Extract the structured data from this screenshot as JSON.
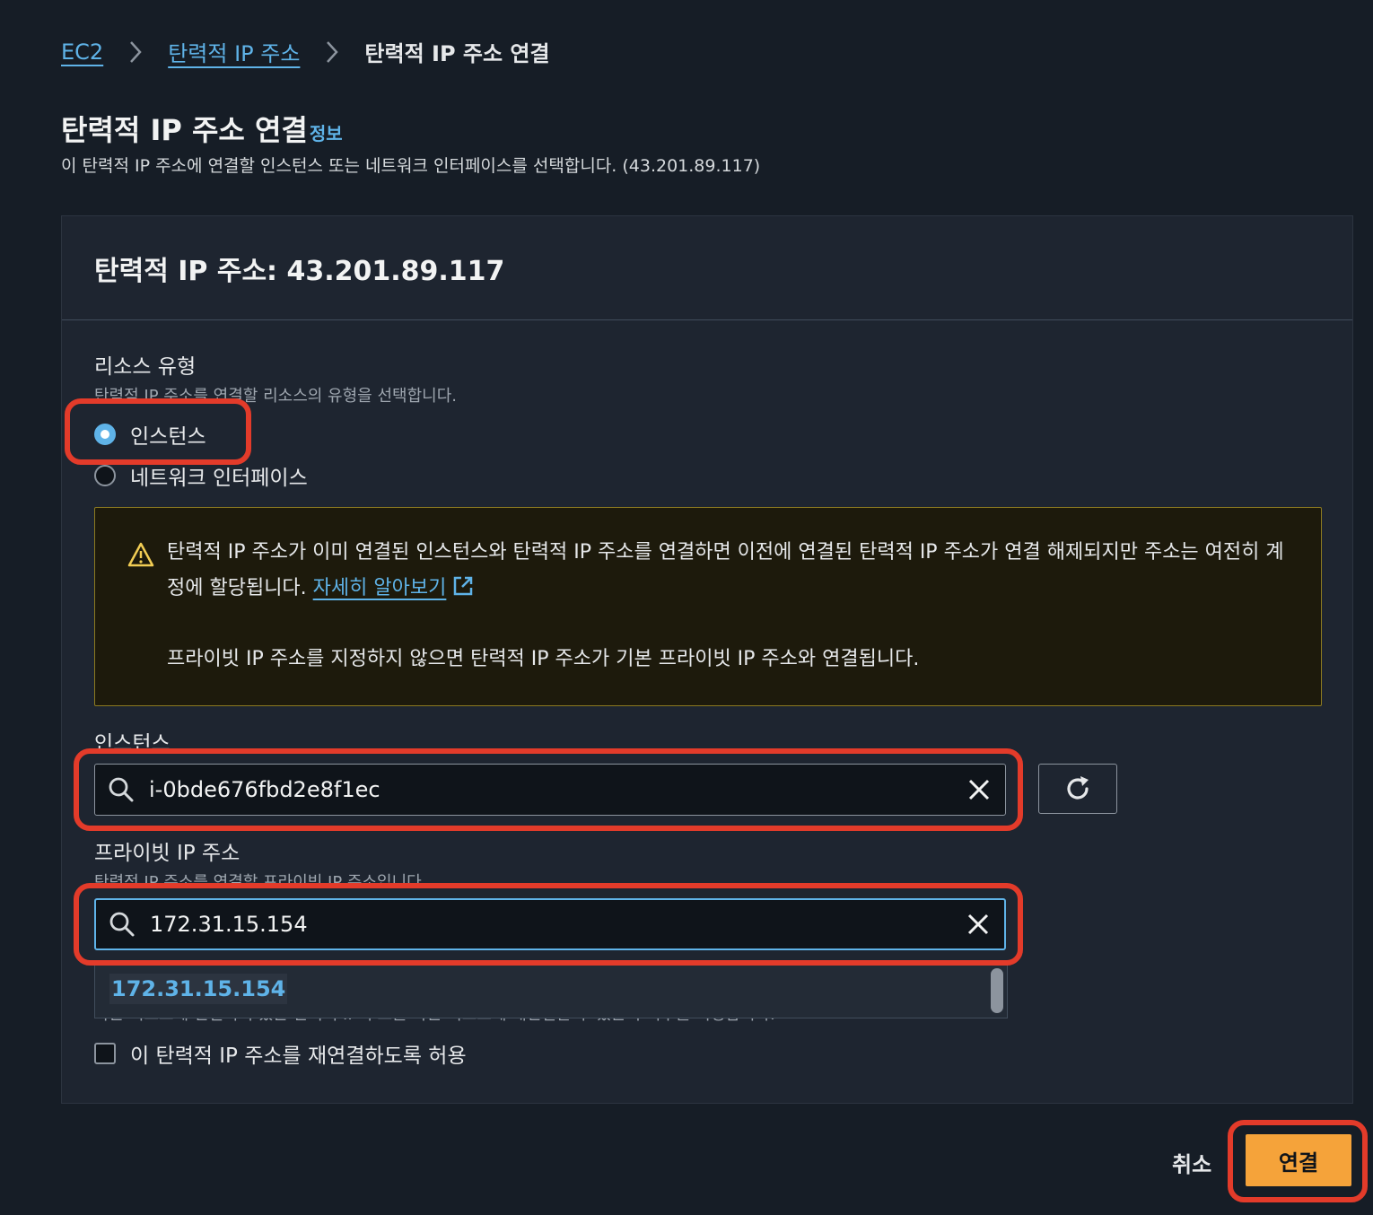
{
  "breadcrumb": {
    "items": [
      "EC2",
      "탄력적 IP 주소"
    ],
    "current": "탄력적 IP 주소 연결"
  },
  "page": {
    "title": "탄력적 IP 주소 연결",
    "info_label": "정보",
    "description": "이 탄력적 IP 주소에 연결할 인스턴스 또는 네트워크 인터페이스를 선택합니다. (43.201.89.117)"
  },
  "panel": {
    "header": "탄력적 IP 주소: 43.201.89.117"
  },
  "resource_type": {
    "label": "리소스 유형",
    "description": "탄력적 IP 주소를 연결할 리소스의 유형을 선택합니다.",
    "options": [
      "인스턴스",
      "네트워크 인터페이스"
    ],
    "selected": "인스턴스"
  },
  "warning": {
    "text": "탄력적 IP 주소가 이미 연결된 인스턴스와 탄력적 IP 주소를 연결하면 이전에 연결된 탄력적 IP 주소가 연결 해제되지만 주소는 여전히 계정에 할당됩니다.",
    "link": "자세히 알아보기",
    "text2": "프라이빗 IP 주소를 지정하지 않으면 탄력적 IP 주소가 기본 프라이빗 IP 주소와 연결됩니다."
  },
  "instance": {
    "label": "인스턴스",
    "value": "i-0bde676fbd2e8f1ec"
  },
  "private_ip": {
    "label": "프라이빗 IP 주소",
    "description": "탄력적 IP 주소를 연결할 프라이빗 IP 주소입니다.",
    "value": "172.31.15.154",
    "dropdown_options": [
      "172.31.15.154"
    ]
  },
  "reassociation": {
    "hidden_description": "다른 리소스에 연결되어 있는 탄력적 IP 주소를 다른 리소스에 재연결할 수 있는지 여부를 지정합니다.",
    "checkbox_label": "이 탄력적 IP 주소를 재연결하도록 허용",
    "checked": false
  },
  "actions": {
    "cancel": "취소",
    "submit": "연결"
  },
  "colors": {
    "background": "#161d26",
    "link": "#5fb3e8",
    "primary": "#f5a33a",
    "highlight": "#e33b2a"
  }
}
